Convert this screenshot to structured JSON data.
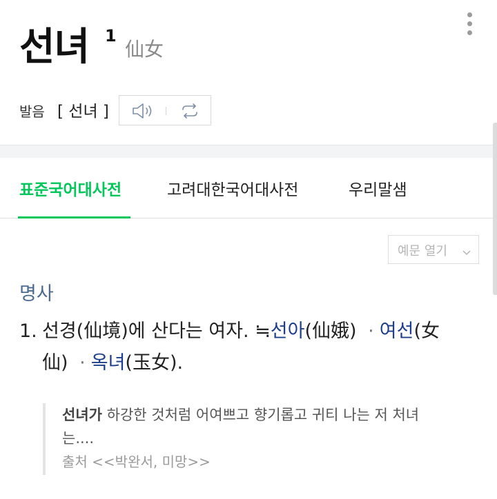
{
  "entry": {
    "word": "선녀",
    "superscript": "1",
    "hanja": "仙女"
  },
  "pronunciation": {
    "label": "발음",
    "value": "[ 선녀 ]"
  },
  "tabs": [
    {
      "label": "표준국어대사전",
      "active": true
    },
    {
      "label": "고려대한국어대사전",
      "active": false
    },
    {
      "label": "우리말샘",
      "active": false
    }
  ],
  "example_toggle": {
    "label": "예문 열기"
  },
  "part_of_speech": "명사",
  "definition": {
    "number": "1.",
    "text": "선경(仙境)에 산다는 여자.",
    "synonym_mark": "≒",
    "syn1_word": "선아",
    "syn1_hanja": "(仙娥)",
    "separator": "·",
    "syn2_word": "여선",
    "syn2_hanja_part1": "(女",
    "syn2_hanja_part2": "仙)",
    "syn3_word": "옥녀",
    "syn3_hanja": "(玉女)."
  },
  "example": {
    "keyword": "선녀가",
    "text_line1": " 하강한 것처럼 어여쁘고 향기롭고 귀티 나는 저 처녀",
    "text_line2": "는....",
    "source": "출처 <<박완서, 미망>>"
  },
  "colors": {
    "accent": "#03c75a",
    "part_of_speech": "#4b6a8f",
    "link": "#1d3e8a"
  }
}
